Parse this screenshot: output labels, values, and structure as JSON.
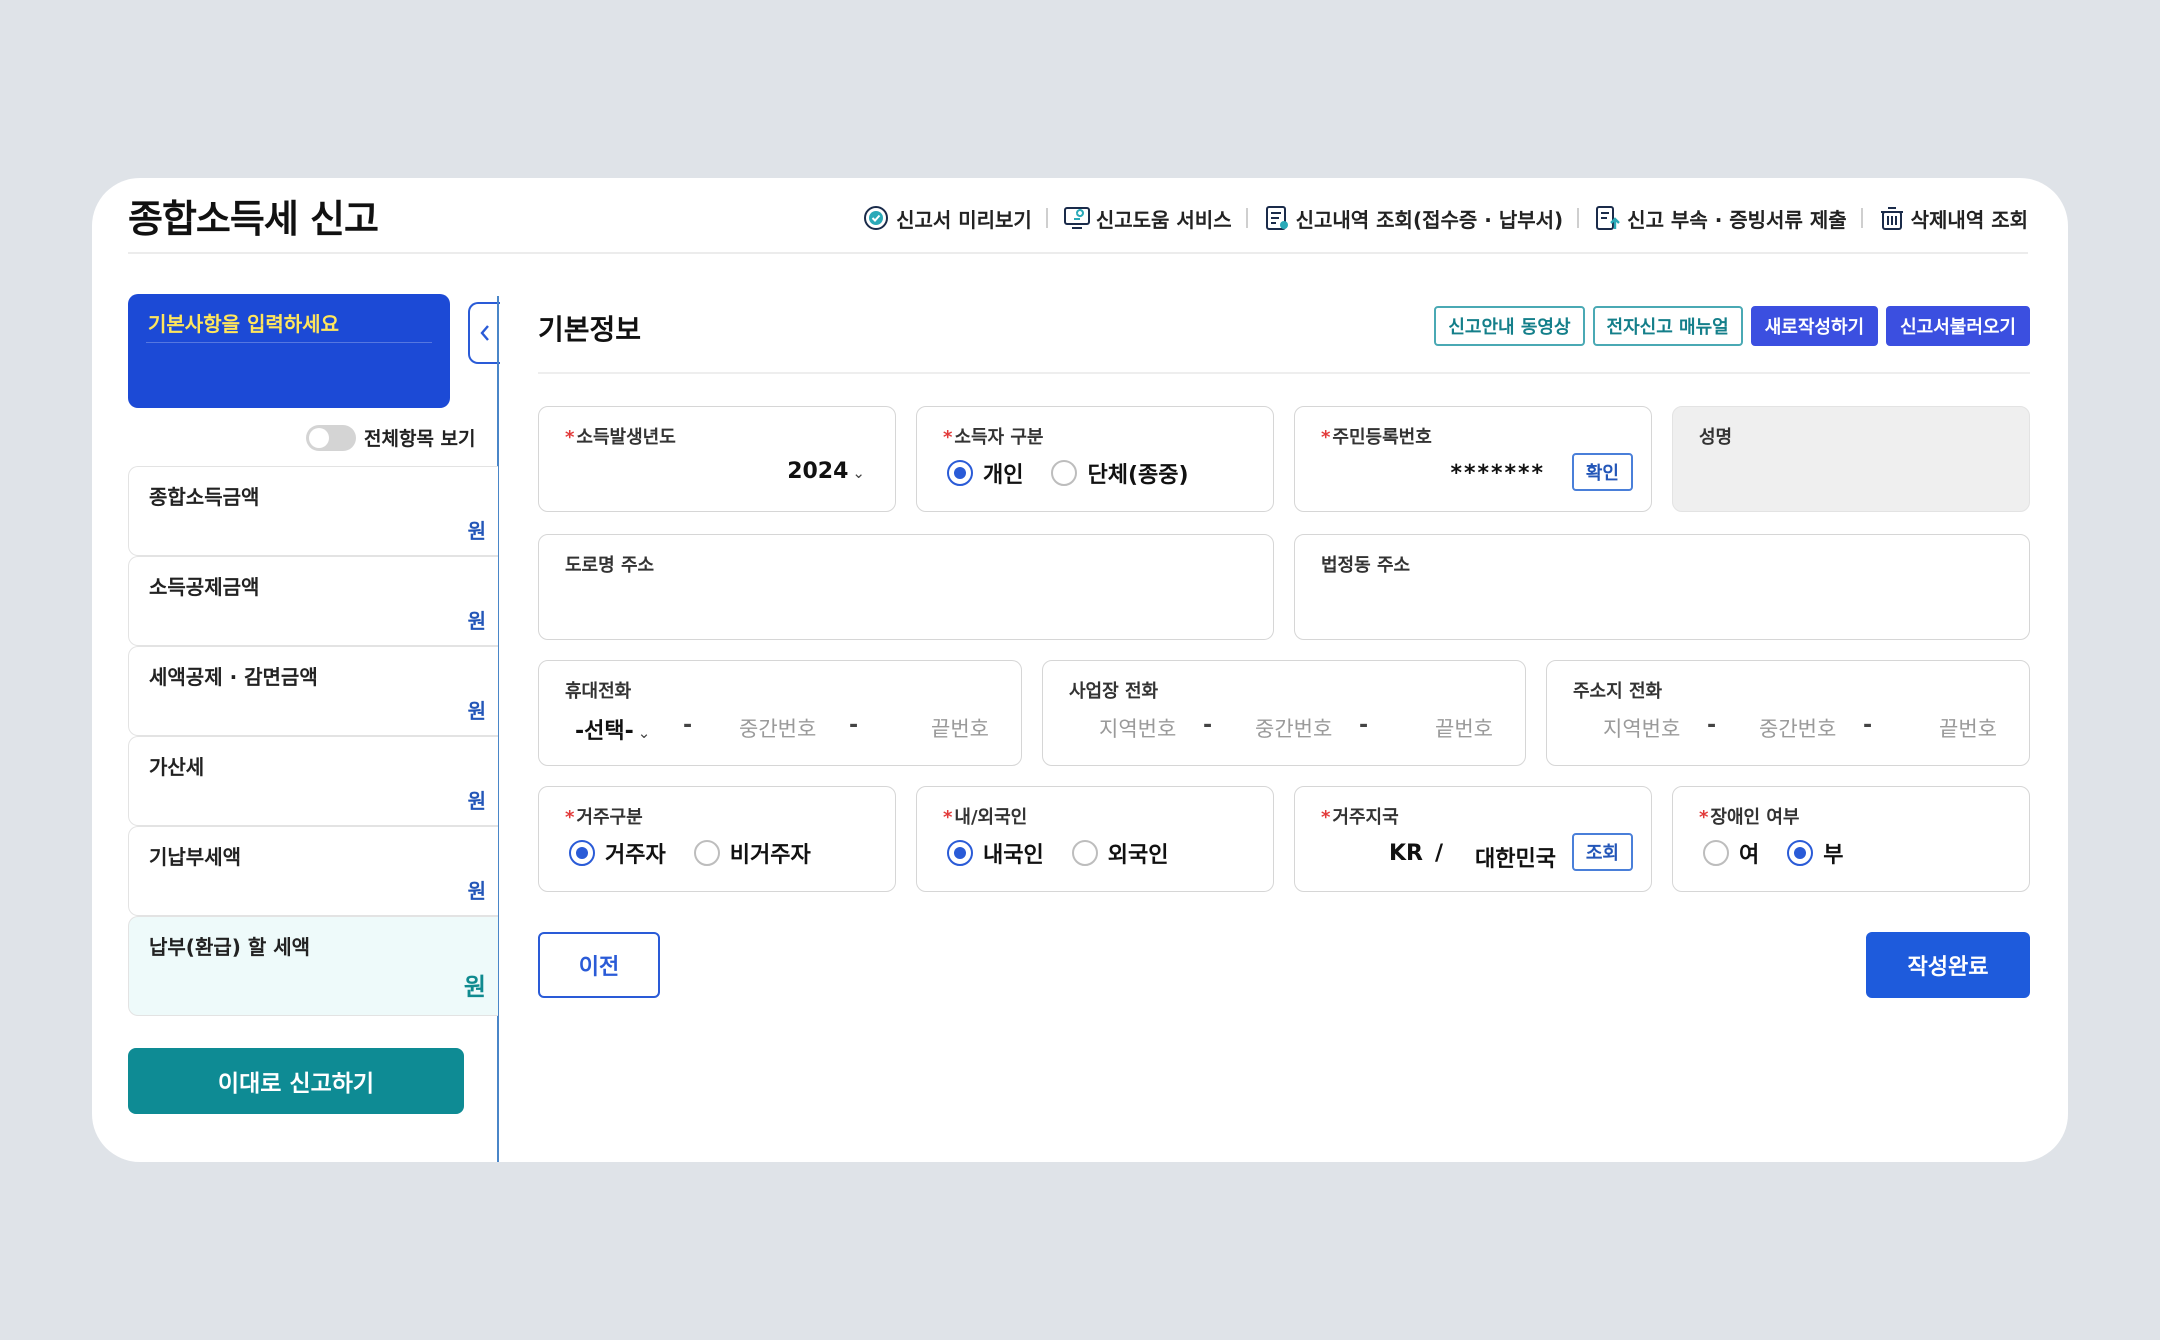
{
  "header": {
    "title": "종합소득세 신고",
    "menu": [
      {
        "label": "신고서 미리보기",
        "icon": "preview-check-icon"
      },
      {
        "label": "신고도움 서비스",
        "icon": "help-service-icon"
      },
      {
        "label": "신고내역 조회(접수증 · 납부서)",
        "icon": "history-doc-icon"
      },
      {
        "label": "신고 부속 · 증빙서류 제출",
        "icon": "upload-doc-icon"
      },
      {
        "label": "삭제내역 조회",
        "icon": "trash-icon"
      }
    ]
  },
  "sidebar": {
    "banner_title": "기본사항을 입력하세요",
    "toggle_label": "전체항목 보기",
    "items": [
      {
        "label": "종합소득금액",
        "unit": "원"
      },
      {
        "label": "소득공제금액",
        "unit": "원"
      },
      {
        "label": "세액공제 · 감면금액",
        "unit": "원"
      },
      {
        "label": "가산세",
        "unit": "원"
      },
      {
        "label": "기납부세액",
        "unit": "원"
      },
      {
        "label": "납부(환급) 할 세액",
        "unit": "원"
      }
    ],
    "submit_label": "이대로 신고하기"
  },
  "main": {
    "section_title": "기본정보",
    "actions": {
      "video": "신고안내 동영상",
      "manual": "전자신고 매뉴얼",
      "new": "새로작성하기",
      "load": "신고서불러오기"
    },
    "year": {
      "label": "소득발생년도",
      "value": "2024"
    },
    "filer_type": {
      "label": "소득자 구분",
      "options": [
        "개인",
        "단체(종중)"
      ],
      "selected": "개인"
    },
    "resident_no": {
      "label": "주민등록번호",
      "value": "*******",
      "button": "확인"
    },
    "name": {
      "label": "성명"
    },
    "road_address": {
      "label": "도로명 주소"
    },
    "legal_address": {
      "label": "법정동 주소"
    },
    "mobile": {
      "label": "휴대전화",
      "select": "-선택-",
      "middle_ph": "중간번호",
      "last_ph": "끝번호"
    },
    "work_phone": {
      "label": "사업장 전화",
      "area_ph": "지역번호",
      "middle_ph": "중간번호",
      "last_ph": "끝번호"
    },
    "home_phone": {
      "label": "주소지 전화",
      "area_ph": "지역번호",
      "middle_ph": "중간번호",
      "last_ph": "끝번호"
    },
    "residency": {
      "label": "거주구분",
      "options": [
        "거주자",
        "비거주자"
      ],
      "selected": "거주자"
    },
    "nationality": {
      "label": "내/외국인",
      "options": [
        "내국인",
        "외국인"
      ],
      "selected": "내국인"
    },
    "country": {
      "label": "거주지국",
      "code": "KR",
      "slash": "/",
      "name": "대한민국",
      "button": "조회"
    },
    "disability": {
      "label": "장애인 여부",
      "options": [
        "여",
        "부"
      ],
      "selected": "부"
    },
    "prev_label": "이전",
    "done_label": "작성완료",
    "dash": "-",
    "required_mark": "*"
  },
  "colors": {
    "banner": "#1c4ad6",
    "banner_text": "#ffe65c",
    "teal": "#0e8b94",
    "primary": "#1e5bdc",
    "action_fill": "#3b4fe0",
    "required": "#e23b3b"
  }
}
